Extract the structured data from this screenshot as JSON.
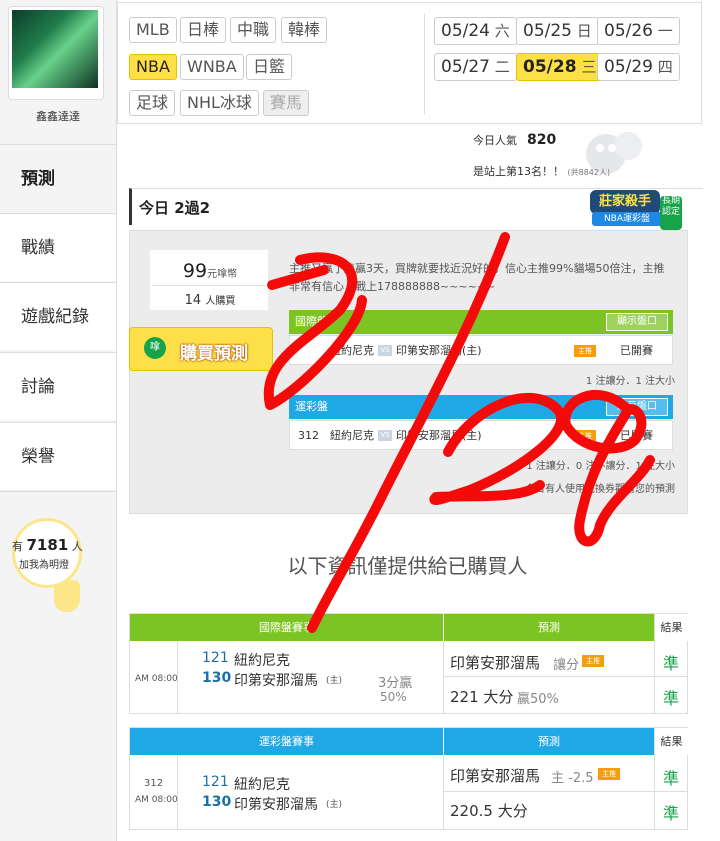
{
  "sidebar": {
    "user_name": "鑫鑫達達",
    "nav": [
      {
        "label": "預測",
        "active": true
      },
      {
        "label": "戰績",
        "active": false
      },
      {
        "label": "遊戲紀錄",
        "active": false
      },
      {
        "label": "討論",
        "active": false
      },
      {
        "label": "榮譽",
        "active": false
      }
    ],
    "popularity": {
      "prefix": "有",
      "count": "7181",
      "suffix": "人",
      "line2": "加我為明燈"
    }
  },
  "filters": {
    "leagues_row1": [
      "MLB",
      "日棒",
      "中職",
      "韓棒"
    ],
    "leagues_row2": [
      "NBA",
      "WNBA",
      "日籃"
    ],
    "leagues_row3": [
      "足球",
      "NHL冰球",
      "賽馬"
    ],
    "active_league": "NBA",
    "dates": [
      {
        "md": "05/24",
        "dow": "六"
      },
      {
        "md": "05/25",
        "dow": "日"
      },
      {
        "md": "05/26",
        "dow": "一"
      },
      {
        "md": "05/27",
        "dow": "二"
      },
      {
        "md": "05/28",
        "dow": "三"
      },
      {
        "md": "05/29",
        "dow": "四"
      }
    ],
    "active_date": "05/28"
  },
  "stats": {
    "today_pop_label": "今日人氣",
    "today_pop_value": "820",
    "rank_text": "是站上第13名！！",
    "rank_small": "(共8842人)"
  },
  "today": {
    "title": "今日 2過2",
    "badge_main": "莊家殺手",
    "badge_sub": "NBA運彩盤",
    "badge_side": "長期認定"
  },
  "purchase": {
    "price": "99",
    "price_unit": "元嗱幣",
    "buyers": "14",
    "buyers_unit": "人購買",
    "buy_label": "購買預測",
    "buy_icon": "嗱",
    "description": "主推又贏了連贏3天，買牌就要找近況好的，信心主推99%貓場50倍注，主推非常有信心，戰上178888888~~~~~~",
    "intl": {
      "title": "國際盤",
      "show_btn": "顯示盤口",
      "teams": "紐約尼克",
      "vs": "VS",
      "opp": "印第安那溜馬(主)",
      "zhu": "主推",
      "status": "已開賽",
      "note": "1 注讓分．1 注大小"
    },
    "sports": {
      "title": "運彩盤",
      "show_btn": "顯示盤口",
      "game_no": "312",
      "teams": "紐約尼克",
      "vs": "VS",
      "opp": "印第安那溜馬(主)",
      "zhu": "主推",
      "status": "已開賽",
      "note": "1 注讓分．0 注不讓分．1 注大小"
    },
    "today_note": "今日有人使用兌換券觀看您的預測"
  },
  "only_buyers": "以下資訊僅提供給已購買人",
  "intl_table": {
    "head_game": "國際盤賽事",
    "head_pred": "預測",
    "head_res": "結果",
    "time": "AM 08:00",
    "away_no": "121",
    "away": "紐約尼克",
    "home_no": "130",
    "home": "印第安那溜馬",
    "home_tag": "(主)",
    "line1": "3分贏",
    "line2": "50%",
    "pred1_team": "印第安那溜馬",
    "pred1_type": "讓分",
    "pred1_tag": "主推",
    "pred2": "221 大分",
    "pred2_extra": "贏50%",
    "res1": "準",
    "res2": "準"
  },
  "sports_table": {
    "head_game": "運彩盤賽事",
    "head_pred": "預測",
    "head_res": "結果",
    "game_no": "312",
    "time": "AM 08:00",
    "away_no": "121",
    "away": "紐約尼克",
    "home_no": "130",
    "home": "印第安那溜馬",
    "home_tag": "(主)",
    "pred1_team": "印第安那溜馬",
    "pred1_type": "主 -2.5",
    "pred1_tag": "主推",
    "pred2": "220.5 大分",
    "res1": "準",
    "res2": "準"
  },
  "annotation": {
    "color": "#f50a0a"
  }
}
